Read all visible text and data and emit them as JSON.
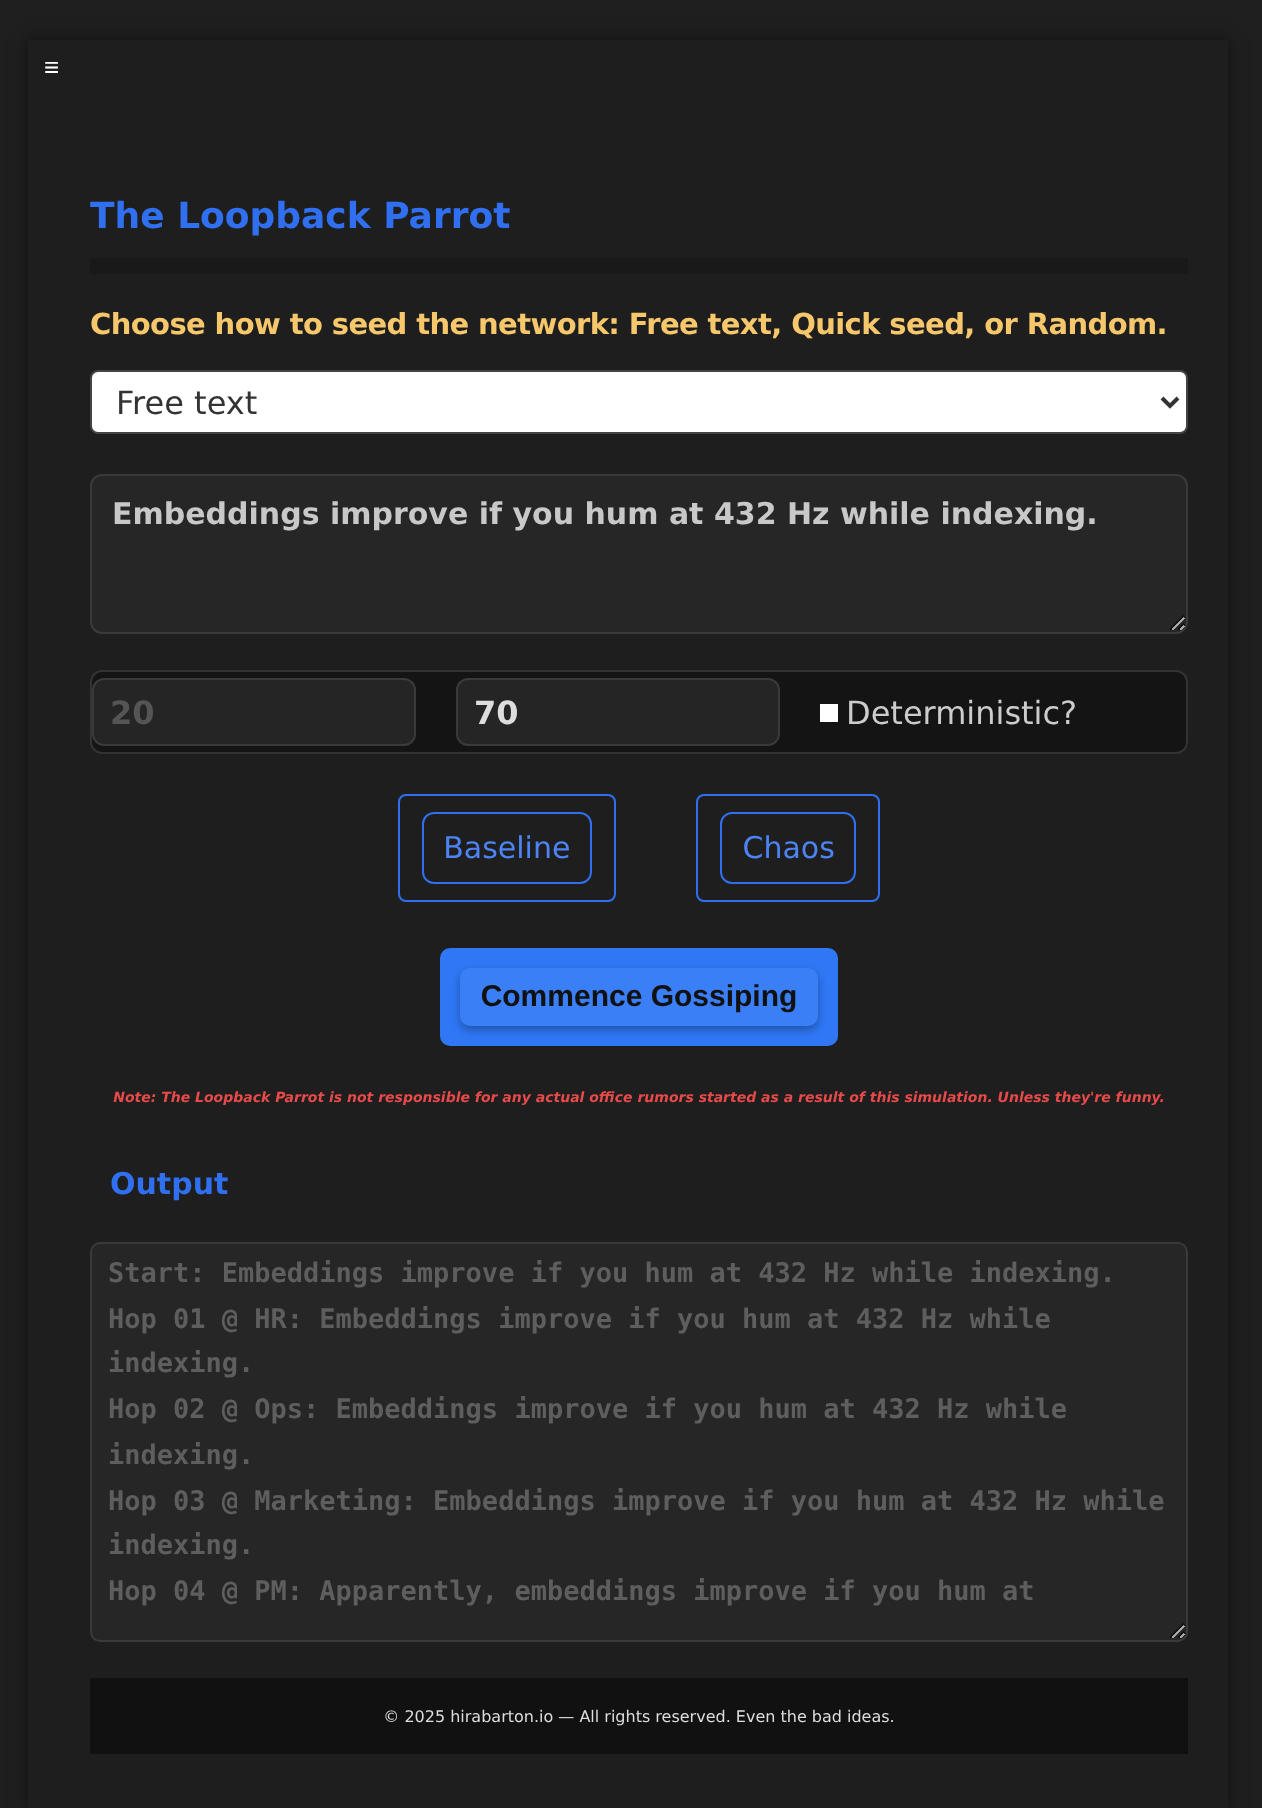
{
  "menu_button": {
    "label": "≡"
  },
  "title": "The Loopback Parrot",
  "instructions": "Choose how to seed the network: Free text, Quick seed, or Random.",
  "seed_mode": {
    "value": "Free text"
  },
  "seed_text": {
    "value": "Embeddings improve if you hum at 432 Hz while indexing."
  },
  "params": [
    {
      "placeholder": "20"
    },
    {
      "value": "70"
    }
  ],
  "deterministic": {
    "label": "Deterministic?",
    "checked": false
  },
  "presets": [
    "Baseline",
    "Chaos"
  ],
  "run_button": "Commence Gossiping",
  "note": "Note: The Loopback Parrot is not responsible for any actual office rumors started as a result of this simulation. Unless they're funny.",
  "output_heading": "Output",
  "output_lines": [
    "Start: Embeddings improve if you hum at 432 Hz while indexing.",
    "Hop 01 @ HR: Embeddings improve if you hum at 432 Hz while indexing.",
    "Hop 02 @ Ops: Embeddings improve if you hum at 432 Hz while indexing.",
    "Hop 03 @ Marketing: Embeddings improve if you hum at 432 Hz while indexing.",
    "Hop 04 @ PM: Apparently, embeddings improve if you hum at"
  ],
  "footer": "© 2025 hirabarton.io — All rights reserved. Even the bad ideas."
}
